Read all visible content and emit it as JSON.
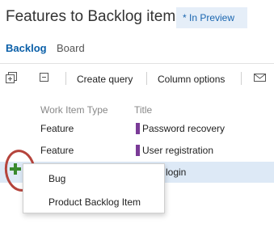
{
  "header": {
    "title": "Features to Backlog items",
    "preview_badge": "* In Preview"
  },
  "tabs": [
    {
      "label": "Backlog",
      "active": true
    },
    {
      "label": "Board",
      "active": false
    }
  ],
  "toolbar": {
    "expand_icon": "expand-all-icon",
    "collapse_icon": "collapse-all-icon",
    "create_query": "Create query",
    "column_options": "Column options",
    "email_icon": "email-icon"
  },
  "table": {
    "columns": [
      "Work Item Type",
      "Title"
    ],
    "rows": [
      {
        "type": "Feature",
        "title": "Password recovery",
        "color": "#7a3b97",
        "selected": false
      },
      {
        "type": "Feature",
        "title": "User registration",
        "color": "#7a3b97",
        "selected": false
      },
      {
        "type": "",
        "title": "login",
        "color": "",
        "selected": true
      }
    ]
  },
  "add_menu": {
    "icon": "plus-icon",
    "items": [
      "Bug",
      "Product Backlog Item"
    ]
  },
  "colors": {
    "accent": "#0a5fa8",
    "feature": "#7a3b97",
    "add": "#3a8a2e",
    "highlight_circle": "#b5443c",
    "selected_row": "#dde9f6"
  }
}
